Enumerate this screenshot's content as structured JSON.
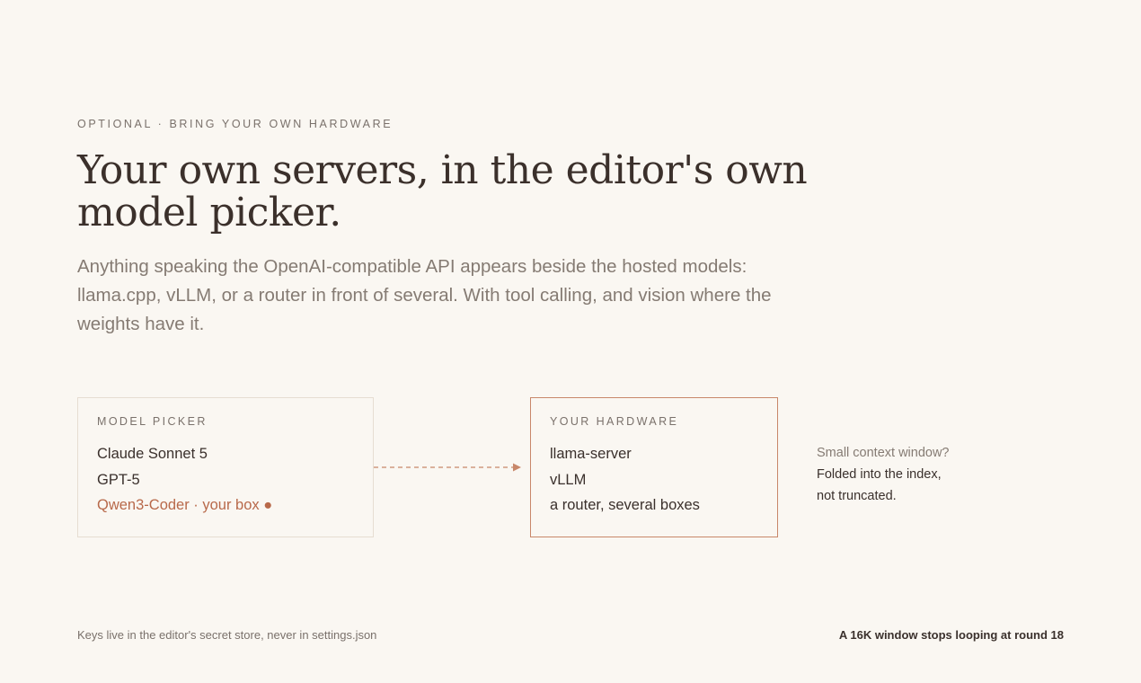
{
  "eyebrow": "OPTIONAL · BRING YOUR OWN HARDWARE",
  "headline": "Your own servers, in the editor's own model picker.",
  "lede": "Anything speaking the OpenAI-compatible API appears beside the hosted models: llama.cpp, vLLM, or a router in front of several. With tool calling, and vision where the weights have it.",
  "model_picker": {
    "label": "MODEL PICKER",
    "items": [
      "Claude Sonnet 5",
      "GPT-5",
      "Qwen3-Coder · your box ●"
    ]
  },
  "hardware": {
    "label": "YOUR HARDWARE",
    "items": [
      "llama-server",
      "vLLM",
      "a router, several boxes"
    ]
  },
  "note": {
    "title": "Small context window?",
    "body": "Folded into the index,\nnot truncated."
  },
  "footer": {
    "left": "Keys live in the editor's secret store, never in settings.json",
    "right": "A 16K window stops looping at round 18"
  },
  "colors": {
    "background": "#faf7f2",
    "accent": "#b8694a",
    "text": "#3a302c",
    "muted": "#857b73"
  }
}
